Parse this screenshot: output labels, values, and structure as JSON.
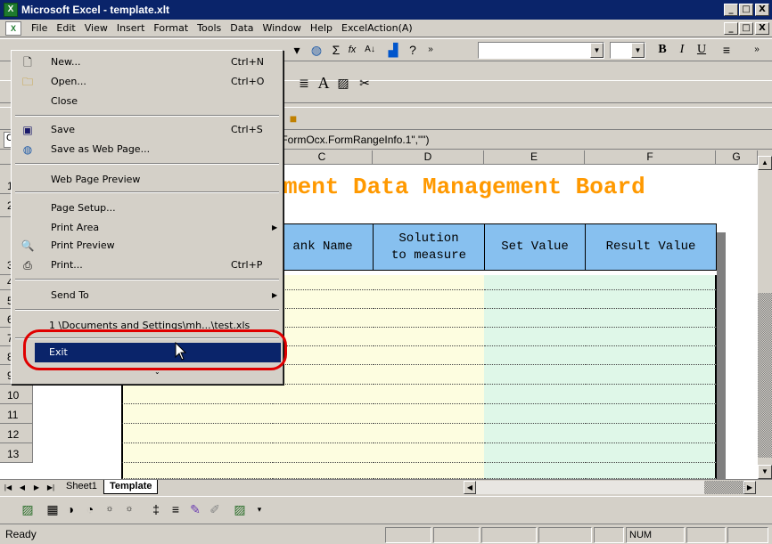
{
  "window": {
    "title": "Microsoft Excel - template.xlt",
    "btn_min": "_",
    "btn_max": "□",
    "btn_close": "X"
  },
  "menubar": {
    "items": [
      "File",
      "Edit",
      "View",
      "Insert",
      "Format",
      "Tools",
      "Data",
      "Window",
      "Help",
      "ExcelAction(A)"
    ]
  },
  "formula": {
    "text": "celFormOcx.FormRangeInfo.1\",\"\")",
    "namebox_fragment": "C"
  },
  "columns": [
    "C",
    "D",
    "E",
    "F",
    "G"
  ],
  "rows": [
    "1",
    "2",
    "3",
    "4",
    "5",
    "6",
    "7",
    "8",
    "9",
    "10",
    "11",
    "12",
    "13"
  ],
  "sheet": {
    "title": "ment Data Management Board",
    "headers": [
      "ank Name",
      "Solution to measure",
      "Set Value",
      "Result Value"
    ],
    "header_lines": {
      "solution_1": "Solution",
      "solution_2": "to measure"
    }
  },
  "tabs": {
    "sheet1": "Sheet1",
    "template": "Template"
  },
  "status": {
    "left": "Ready",
    "num": "NUM"
  },
  "file_menu": {
    "items": [
      {
        "label": "New...",
        "shortcut": "Ctrl+N",
        "icon": "new-document-icon"
      },
      {
        "label": "Open...",
        "shortcut": "Ctrl+O",
        "icon": "open-folder-icon"
      },
      {
        "label": "Close",
        "shortcut": ""
      },
      {
        "label": "Save",
        "shortcut": "Ctrl+S",
        "icon": "save-disk-icon"
      },
      {
        "label": "Save as Web Page...",
        "shortcut": "",
        "icon": "web-page-icon"
      },
      {
        "label": "Web Page Preview",
        "shortcut": ""
      },
      {
        "label": "Page Setup...",
        "shortcut": ""
      },
      {
        "label": "Print Area",
        "shortcut": "",
        "submenu": true
      },
      {
        "label": "Print Preview",
        "shortcut": "",
        "icon": "print-preview-icon"
      },
      {
        "label": "Print...",
        "shortcut": "Ctrl+P",
        "icon": "printer-icon"
      },
      {
        "label": "Send To",
        "shortcut": "",
        "submenu": true
      },
      {
        "label": "1 \\Documents and Settings\\mh...\\test.xls",
        "shortcut": ""
      },
      {
        "label": "Exit",
        "shortcut": "",
        "highlighted": true
      }
    ]
  },
  "colors": {
    "title_orange": "#ff9900",
    "header_blue": "#87c0ef",
    "yellow_cell": "#fdfde0",
    "green_cell": "#dff7e8",
    "highlight": "#0a246a",
    "annotation_red": "#e00000"
  }
}
